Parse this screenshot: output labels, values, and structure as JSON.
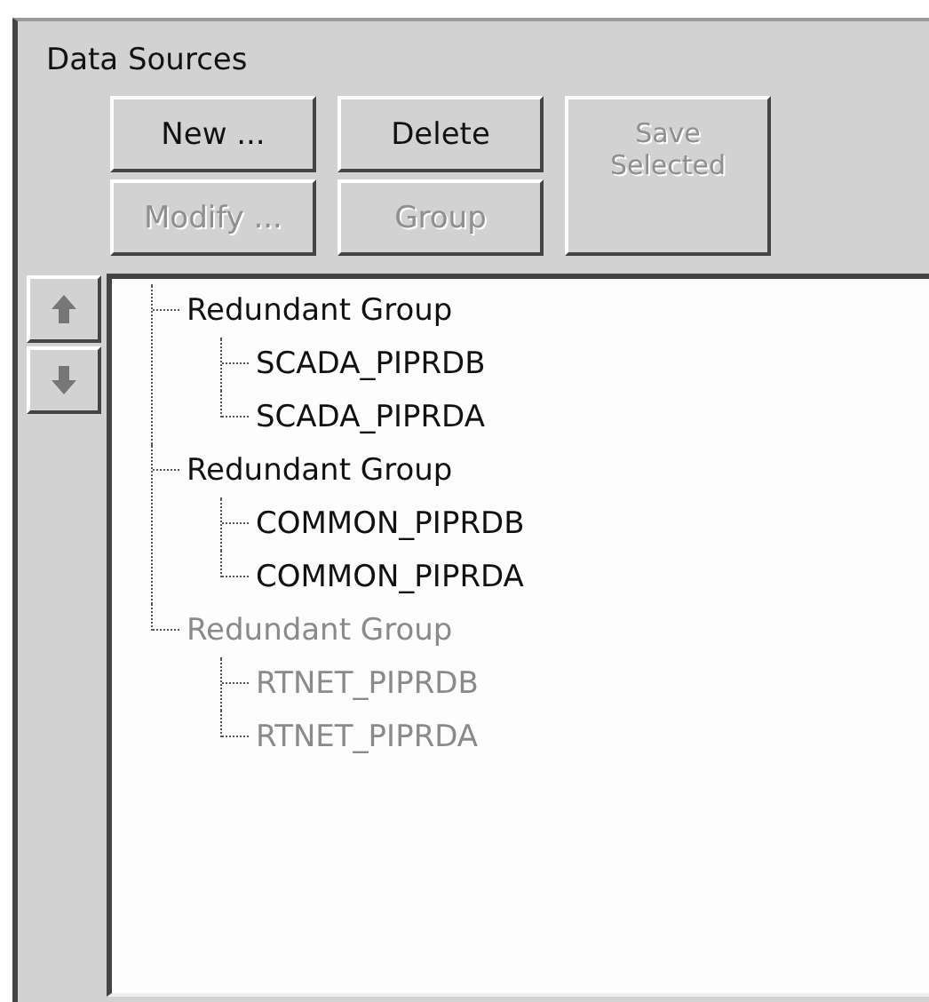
{
  "panel": {
    "title": "Data Sources"
  },
  "buttons": [
    {
      "label": "New ...",
      "disabled": false
    },
    {
      "label": "Delete",
      "disabled": false
    },
    {
      "label": "Save Selected",
      "disabled": true
    },
    {
      "label": "Modify ...",
      "disabled": true
    },
    {
      "label": "Group",
      "disabled": true
    }
  ],
  "order_buttons": [
    {
      "kind": "up"
    },
    {
      "kind": "down"
    }
  ],
  "tree": [
    {
      "label": "Redundant Group",
      "disabled": false,
      "children": [
        {
          "label": "SCADA_PIPRDB",
          "disabled": false
        },
        {
          "label": "SCADA_PIPRDA",
          "disabled": false
        }
      ]
    },
    {
      "label": "Redundant Group",
      "disabled": false,
      "children": [
        {
          "label": "COMMON_PIPRDB",
          "disabled": false
        },
        {
          "label": "COMMON_PIPRDA",
          "disabled": false
        }
      ]
    },
    {
      "label": "Redundant Group",
      "disabled": true,
      "children": [
        {
          "label": "RTNET_PIPRDB",
          "disabled": true
        },
        {
          "label": "RTNET_PIPRDA",
          "disabled": true
        }
      ]
    }
  ]
}
